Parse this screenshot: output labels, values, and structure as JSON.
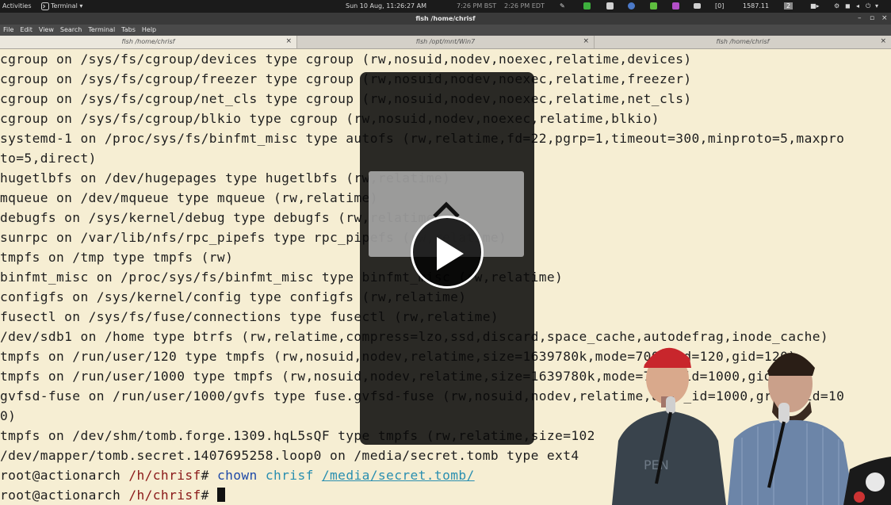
{
  "topbar": {
    "activities": "Activities",
    "app_menu": "Terminal",
    "clock": "Sun 10 Aug, 11:26:27 AM",
    "tz1": "7:26 PM BST",
    "tz2": "2:26 PM EDT",
    "bracket": "[0]",
    "number": "1587.11",
    "badge": "2"
  },
  "window": {
    "title": "fish /home/chrisf",
    "min_glyph": "–",
    "max_glyph": "▫",
    "close_glyph": "×"
  },
  "menubar": {
    "items": [
      "File",
      "Edit",
      "View",
      "Search",
      "Terminal",
      "Tabs",
      "Help"
    ]
  },
  "tabs": [
    {
      "label": "fish /home/chrisf",
      "close": "×"
    },
    {
      "label": "fish /opt/mnt/Win7",
      "close": "×"
    },
    {
      "label": "fish /home/chrisf",
      "close": "×"
    }
  ],
  "terminal": {
    "lines": [
      "cgroup on /sys/fs/cgroup/devices type cgroup (rw,nosuid,nodev,noexec,relatime,devices)",
      "cgroup on /sys/fs/cgroup/freezer type cgroup (rw,nosuid,nodev,noexec,relatime,freezer)",
      "cgroup on /sys/fs/cgroup/net_cls type cgroup (rw,nosuid,nodev,noexec,relatime,net_cls)",
      "cgroup on /sys/fs/cgroup/blkio type cgroup (rw,nosuid,nodev,noexec,relatime,blkio)",
      "systemd-1 on /proc/sys/fs/binfmt_misc type autofs (rw,relatime,fd=22,pgrp=1,timeout=300,minproto=5,maxpro",
      "to=5,direct)",
      "hugetlbfs on /dev/hugepages type hugetlbfs (rw,relatime)",
      "mqueue on /dev/mqueue type mqueue (rw,relatime)",
      "debugfs on /sys/kernel/debug type debugfs (rw,relatime)",
      "sunrpc on /var/lib/nfs/rpc_pipefs type rpc_pipefs (rw,relatime)",
      "tmpfs on /tmp type tmpfs (rw)",
      "binfmt_misc on /proc/sys/fs/binfmt_misc type binfmt_misc (rw,relatime)",
      "configfs on /sys/kernel/config type configfs (rw,relatime)",
      "fusectl on /sys/fs/fuse/connections type fusectl (rw,relatime)",
      "/dev/sdb1 on /home type btrfs (rw,relatime,compress=lzo,ssd,discard,space_cache,autodefrag,inode_cache)",
      "tmpfs on /run/user/120 type tmpfs (rw,nosuid,nodev,relatime,size=1639780k,mode=700,uid=120,gid=120)",
      "tmpfs on /run/user/1000 type tmpfs (rw,nosuid,nodev,relatime,size=1639780k,mode=700,uid=1000,gid=100)",
      "gvfsd-fuse on /run/user/1000/gvfs type fuse.gvfsd-fuse (rw,nosuid,nodev,relatime,user_id=1000,group_id=10",
      "0)",
      "tmpfs on /dev/shm/tomb.forge.1309.hqL5sQF type tmpfs (rw,relatime,size=102",
      "/dev/mapper/tomb.secret.1407695258.loop0 on /media/secret.tomb type ext4"
    ],
    "prompt_user": "root@actionarch",
    "prompt_dir": "/h/chrisf",
    "prompt_symbol": "#",
    "cmd_name": "chown",
    "cmd_arg": "chrisf",
    "cmd_path": "/media/secret.tomb/"
  },
  "colors": {
    "terminal_bg": "#f6eed3",
    "prompt_dir": "#8b1a1a",
    "command": "#1f4aa8",
    "argument": "#2a8fb0"
  }
}
